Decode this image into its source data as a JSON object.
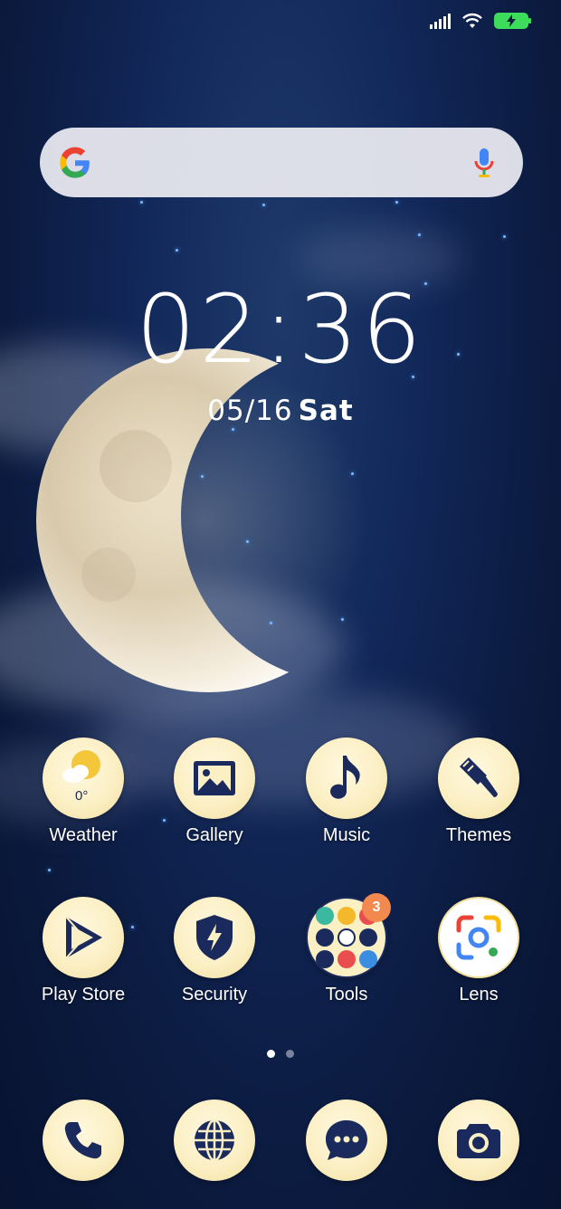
{
  "status_bar": {
    "signal_icon": "signal-icon",
    "wifi_icon": "wifi-icon",
    "battery_icon": "battery-charging-icon",
    "battery_color": "#3ddc5a"
  },
  "search_bar": {
    "logo_icon": "google-g-icon",
    "mic_icon": "microphone-icon"
  },
  "clock": {
    "time": "02:36",
    "date": "05/16",
    "weekday": "Sat"
  },
  "apps_row1": [
    {
      "label": "Weather",
      "icon": "weather-sun-cloud-icon",
      "value": "0°"
    },
    {
      "label": "Gallery",
      "icon": "image-icon"
    },
    {
      "label": "Music",
      "icon": "music-note-icon"
    },
    {
      "label": "Themes",
      "icon": "paint-brush-icon"
    }
  ],
  "apps_row2": [
    {
      "label": "Play Store",
      "icon": "play-store-icon"
    },
    {
      "label": "Security",
      "icon": "shield-bolt-icon"
    },
    {
      "label": "Tools",
      "icon": "folder-icon",
      "badge": "3"
    },
    {
      "label": "Lens",
      "icon": "google-lens-icon"
    }
  ],
  "page_indicator": {
    "pages": 2,
    "current": 1
  },
  "dock": [
    {
      "icon": "phone-icon"
    },
    {
      "icon": "browser-globe-icon"
    },
    {
      "icon": "messages-icon"
    },
    {
      "icon": "camera-icon"
    }
  ],
  "colors": {
    "accent_icon_bg": "#fbefc4",
    "icon_glyph": "#1a2a5c",
    "badge": "#f28a4f"
  }
}
